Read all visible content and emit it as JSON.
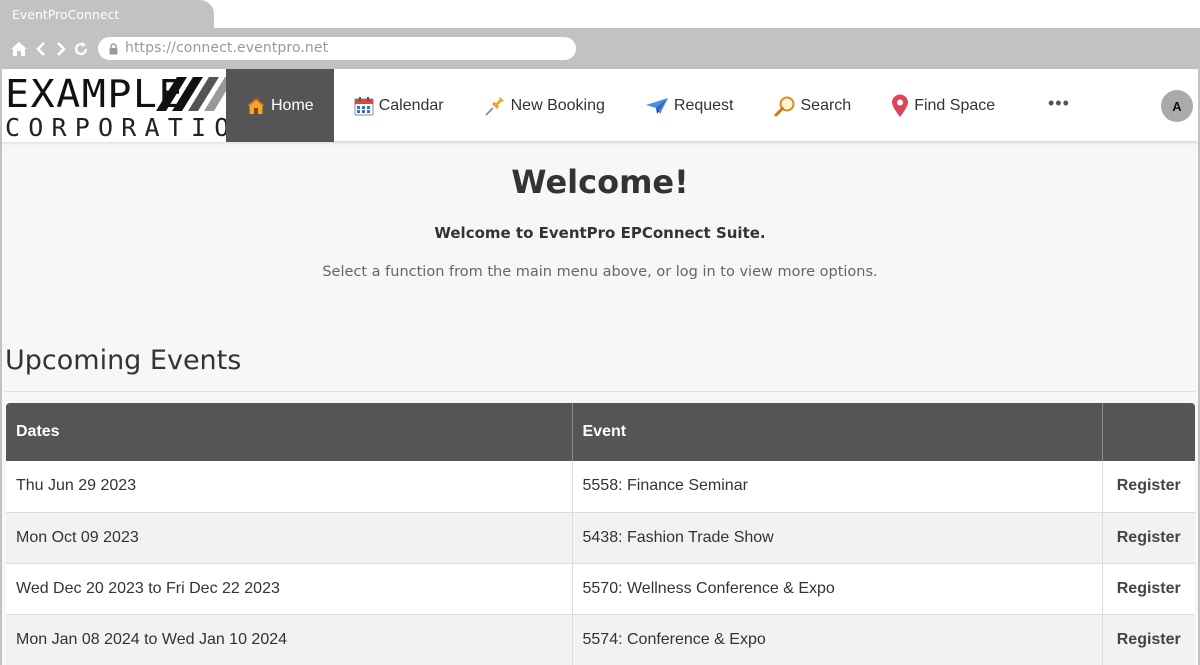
{
  "browser": {
    "tab_title": "EventProConnect",
    "url": "https://connect.eventpro.net"
  },
  "logo": {
    "line1": "EXAMPLE",
    "line2": "CORPORATION"
  },
  "nav": {
    "items": [
      {
        "label": "Home",
        "icon": "house-icon",
        "active": true
      },
      {
        "label": "Calendar",
        "icon": "calendar-icon"
      },
      {
        "label": "New Booking",
        "icon": "pushpin-icon"
      },
      {
        "label": "Request",
        "icon": "paper-plane-icon"
      },
      {
        "label": "Search",
        "icon": "magnifier-icon"
      },
      {
        "label": "Find Space",
        "icon": "map-pin-icon"
      }
    ],
    "more_label": "•••",
    "avatar_initial": "A"
  },
  "welcome": {
    "title": "Welcome!",
    "subtitle": "Welcome to EventPro EPConnect Suite.",
    "hint": "Select a function from the main menu above, or log in to view more options."
  },
  "events": {
    "title": "Upcoming Events",
    "columns": [
      "Dates",
      "Event",
      ""
    ],
    "rows": [
      {
        "dates": "Thu Jun 29 2023",
        "event": "5558: Finance Seminar",
        "action": "Register"
      },
      {
        "dates": "Mon Oct 09 2023",
        "event": "5438: Fashion Trade Show",
        "action": "Register"
      },
      {
        "dates": "Wed Dec 20 2023 to Fri Dec 22 2023",
        "event": "5570: Wellness Conference & Expo",
        "action": "Register"
      },
      {
        "dates": "Mon Jan 08 2024 to Wed Jan 10 2024",
        "event": "5574: Conference & Expo",
        "action": "Register"
      }
    ]
  },
  "colors": {
    "nav_active_bg": "#555555",
    "table_header_bg": "#555555",
    "page_bg": "#f7f7f7",
    "chrome_bg": "#c2c2c2"
  }
}
